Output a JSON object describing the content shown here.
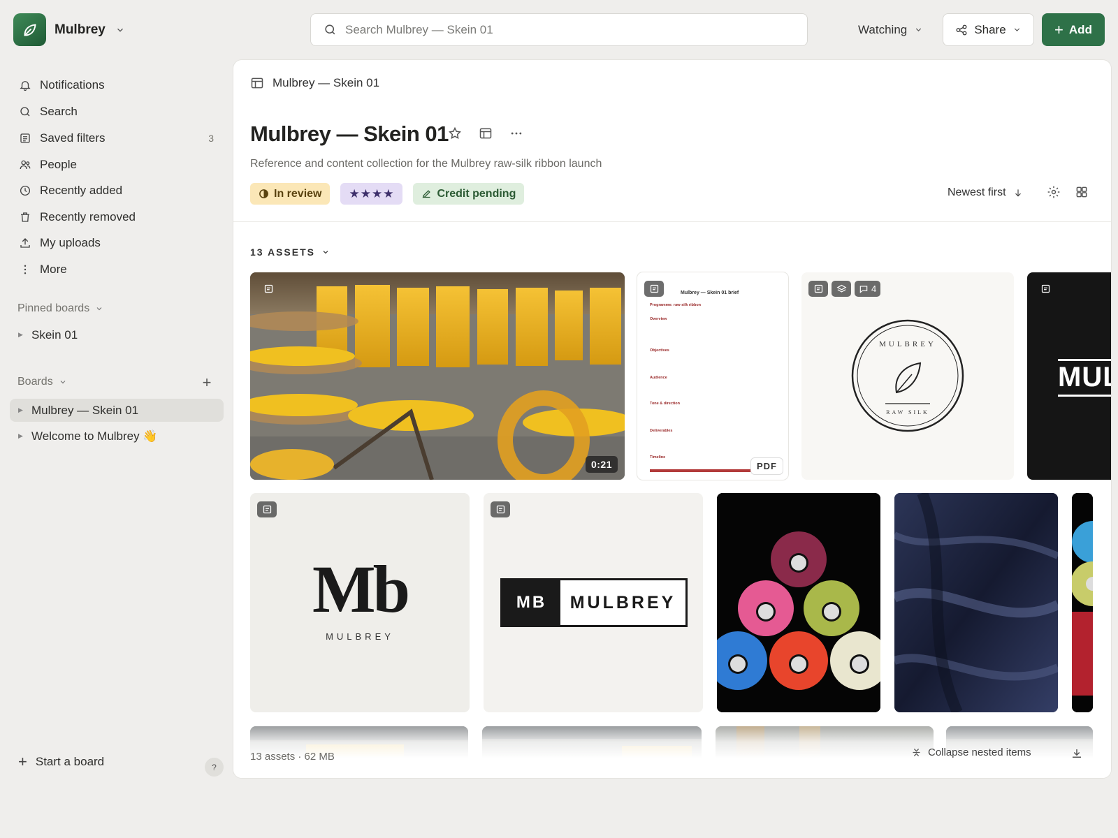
{
  "workspace": {
    "name": "Mulbrey",
    "logo_icon": "leaf-icon",
    "accent": "#2e7148"
  },
  "search": {
    "placeholder": "Search Mulbrey — Skein 01"
  },
  "header": {
    "watching_label": "Watching",
    "share_label": "Share",
    "add_label": "Add"
  },
  "sidebar": {
    "items": [
      {
        "label": "Notifications",
        "icon": "bell-icon"
      },
      {
        "label": "Search",
        "icon": "search-icon"
      },
      {
        "label": "Saved filters",
        "icon": "filter-icon",
        "count": "3"
      },
      {
        "label": "People",
        "icon": "people-icon"
      },
      {
        "label": "Recently added",
        "icon": "clock-icon"
      },
      {
        "label": "Recently removed",
        "icon": "trash-icon"
      },
      {
        "label": "My uploads",
        "icon": "upload-icon"
      },
      {
        "label": "More",
        "icon": "more-vertical-icon"
      }
    ],
    "pinned_heading": "Pinned boards",
    "pinned": [
      {
        "label": "Skein 01"
      }
    ],
    "boards_heading": "Boards",
    "boards": [
      {
        "label": "Mulbrey — Skein 01",
        "active": true
      },
      {
        "label": "Welcome to Mulbrey 👋",
        "active": false
      }
    ],
    "start_board_label": "Start a board",
    "help_label": "?"
  },
  "main": {
    "breadcrumb": "Mulbrey — Skein 01",
    "title": "Mulbrey — Skein 01",
    "description": "Reference and content collection for the Mulbrey raw-silk ribbon launch",
    "tags": {
      "status": "In review",
      "rating_stars": "★★★★",
      "rating_value": 4,
      "credit": "Credit pending"
    },
    "sort_label": "Newest first",
    "assets_heading": "13 ASSETS",
    "footer_info": "13 assets · 62 MB",
    "collapse_label": "Collapse nested items"
  },
  "cards": {
    "video": {
      "duration": "0:21"
    },
    "brief": {
      "title": "Mulbrey — Skein 01 brief",
      "programme": "Programme: raw-silk ribbon",
      "sections": [
        "Overview",
        "Objectives",
        "Audience",
        "Tone & direction",
        "Deliverables",
        "Timeline"
      ],
      "badge": "PDF"
    },
    "seal": {
      "top_text": "MULBREY",
      "bottom_text": "RAW SILK",
      "comment_count": "4"
    },
    "dark_logo": {
      "text": "MUL"
    },
    "monogram": {
      "mark": "Mb",
      "wordmark": "MULBREY"
    },
    "lockup": {
      "mark": "MB",
      "wordmark": "MULBREY"
    }
  }
}
